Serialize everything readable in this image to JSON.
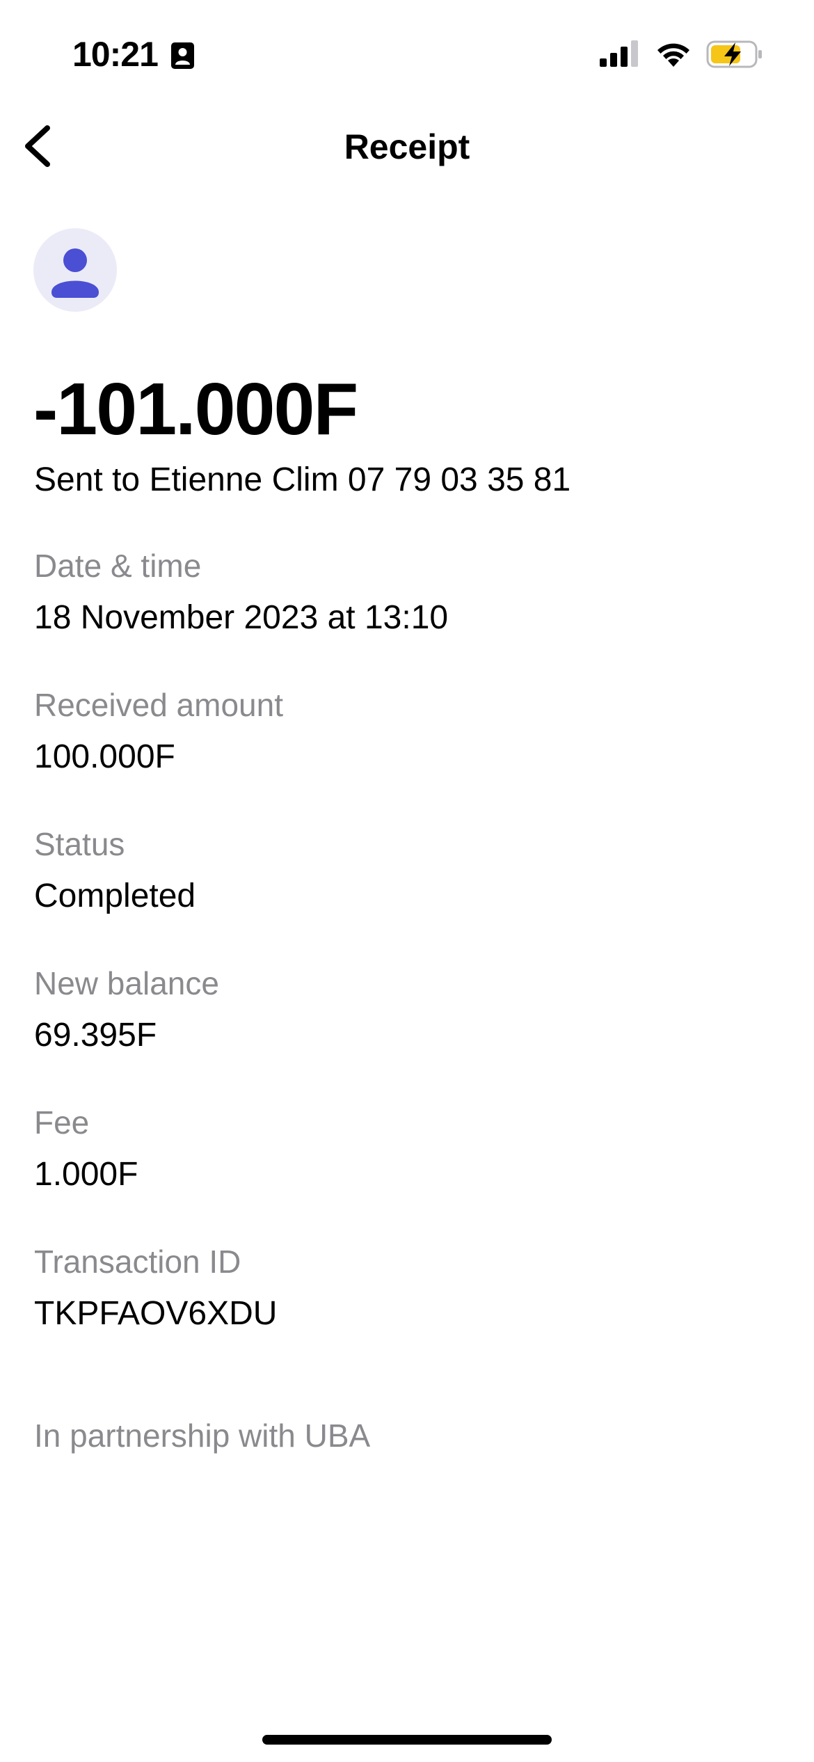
{
  "status_bar": {
    "time": "10:21",
    "icons": [
      "id-card-icon",
      "cellular-signal-icon",
      "wifi-icon",
      "battery-charging-icon"
    ],
    "battery_color": "#f5c518"
  },
  "nav": {
    "back_icon": "chevron-left-icon",
    "title": "Receipt"
  },
  "avatar": {
    "icon": "person-icon",
    "accent_color": "#4a4fd4",
    "background_color": "#ebebf8"
  },
  "transaction": {
    "amount": "-101.000F",
    "recipient_line": "Sent to Etienne Clim 07 79 03 35 81"
  },
  "details": [
    {
      "label": "Date & time",
      "value": "18 November 2023 at 13:10"
    },
    {
      "label": "Received amount",
      "value": "100.000F"
    },
    {
      "label": "Status",
      "value": "Completed"
    },
    {
      "label": "New balance",
      "value": "69.395F"
    },
    {
      "label": "Fee",
      "value": "1.000F"
    },
    {
      "label": "Transaction ID",
      "value": "TKPFAOV6XDU"
    }
  ],
  "footer": {
    "partnership": "In partnership with UBA"
  }
}
